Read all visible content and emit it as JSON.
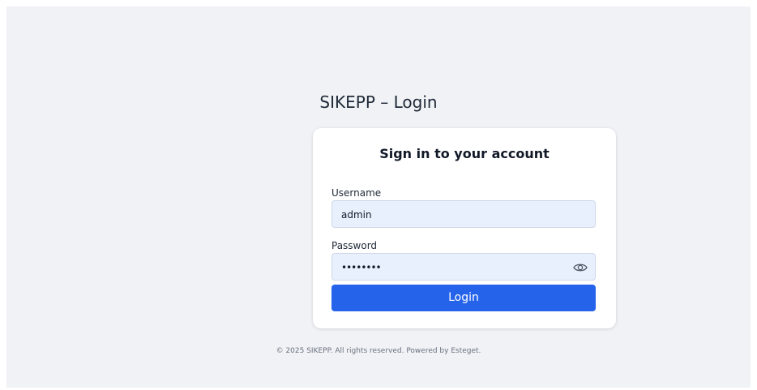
{
  "header": {
    "title": "SIKEPP – Login"
  },
  "login_card": {
    "title": "Sign in to your account",
    "username": {
      "label": "Username",
      "value": "admin"
    },
    "password": {
      "label": "Password",
      "masked_value": "••••••••",
      "toggle_icon": "eye-icon"
    },
    "login_button_label": "Login"
  },
  "footer": {
    "text": "© 2025 SIKEPP. All rights reserved. Powered by Esteget."
  },
  "colors": {
    "page_background": "#f0f2f5",
    "card_background": "#ffffff",
    "input_background": "#e8f0fe",
    "primary_button": "#2563eb",
    "footer_text": "#6b7280"
  }
}
